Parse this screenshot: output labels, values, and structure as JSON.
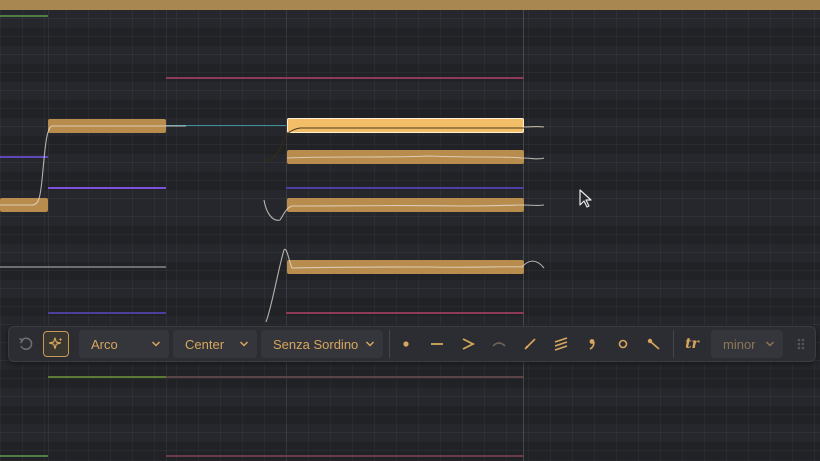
{
  "toolbar": {
    "undo_icon": "undo-icon",
    "sparkle_icon": "sparkle-icon",
    "technique": {
      "selected": "Arco"
    },
    "position": {
      "selected": "Center"
    },
    "mute": {
      "selected": "Senza Sordino"
    },
    "articulations": [
      "staccato-icon",
      "tenuto-icon",
      "accent-icon",
      "slur-icon",
      "glissando-icon",
      "tremolo-icon",
      "breath-mark-icon",
      "harmonic-icon",
      "portamento-icon"
    ],
    "trill": {
      "label": "tr",
      "mode": "minor"
    },
    "drag_handle_icon": "drag-handle-icon"
  },
  "colors": {
    "background": "#26272c",
    "note": "#b78c4d",
    "note_selected": "#f2be67",
    "accent": "#d7a65d",
    "lane_purple": "#6a4fd0",
    "lane_pink": "#b04b6c",
    "lane_teal": "#3d8f9a",
    "lane_green": "#6b8a3a"
  }
}
